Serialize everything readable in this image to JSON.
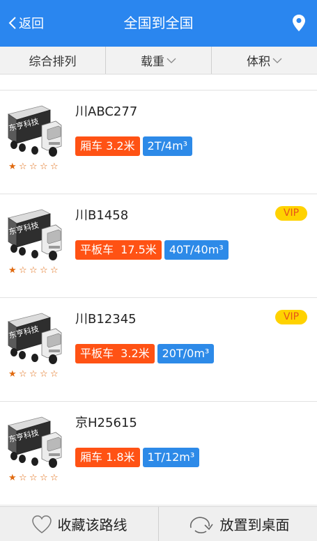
{
  "header": {
    "back_label": "返回",
    "title": "全国到全国",
    "location_icon": "location-pin-icon"
  },
  "sort_tabs": [
    {
      "label": "综合排列",
      "has_chevron": false
    },
    {
      "label": "载重",
      "has_chevron": true
    },
    {
      "label": "体积",
      "has_chevron": true
    }
  ],
  "vehicles": [
    {
      "plate": "川ABC277",
      "type_tag": "厢车 3.2米",
      "capacity_tag": "2T/4m³",
      "vip": false,
      "vip_label": "",
      "rating": 1,
      "logo_text": "东亨科技"
    },
    {
      "plate": "川B1458",
      "type_tag": "平板车  17.5米",
      "capacity_tag": "40T/40m³",
      "vip": true,
      "vip_label": "VIP",
      "rating": 1,
      "logo_text": "东亨科技"
    },
    {
      "plate": "川B12345",
      "type_tag": "平板车  3.2米",
      "capacity_tag": "20T/0m³",
      "vip": true,
      "vip_label": "VIP",
      "rating": 1,
      "logo_text": "东亨科技"
    },
    {
      "plate": "京H25615",
      "type_tag": "厢车 1.8米",
      "capacity_tag": "1T/12m³",
      "vip": false,
      "vip_label": "",
      "rating": 1,
      "logo_text": "东亨科技"
    }
  ],
  "footer": {
    "favorite_label": "收藏该路线",
    "desktop_label": "放置到桌面"
  },
  "colors": {
    "header_bg": "#2a86ef",
    "type_tag": "#ff5214",
    "capacity_tag": "#2d8ae8",
    "vip_bg": "#ffd200",
    "star": "#e06a10"
  }
}
